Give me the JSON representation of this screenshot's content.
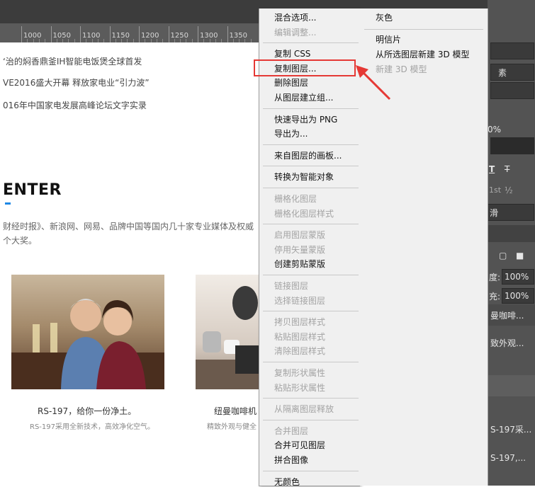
{
  "ruler": {
    "ticks": [
      "1000",
      "1050",
      "1100",
      "1150",
      "1200",
      "1250",
      "1300",
      "1350"
    ]
  },
  "canvas": {
    "news": [
      "‘治的焖香鼎釜IH智能电饭煲全球首发",
      "VE2016盛大开幕 释放家电业“引力波”",
      "016年中国家电发展高峰论坛文字实录"
    ],
    "section_title": "ENTER",
    "desc_line1": "财经时报》、新浪网、网易、品牌中国等国内几十家专业媒体及权威",
    "desc_line2": "个大奖。",
    "product1": {
      "title": "RS-197，给你一份净土。",
      "subtitle": "RS-197采用全新技术，高效净化空气。"
    },
    "product2": {
      "title": "纽曼咖啡机",
      "subtitle": "精致外观与健全"
    }
  },
  "context_menu": {
    "groups": [
      [
        {
          "label": "混合选项...",
          "enabled": true
        },
        {
          "label": "编辑调整...",
          "enabled": false
        }
      ],
      [
        {
          "label": "复制 CSS",
          "enabled": true
        },
        {
          "label": "复制图层...",
          "enabled": true,
          "highlighted": true
        },
        {
          "label": "删除图层",
          "enabled": true
        },
        {
          "label": "从图层建立组...",
          "enabled": true
        }
      ],
      [
        {
          "label": "快速导出为 PNG",
          "enabled": true
        },
        {
          "label": "导出为...",
          "enabled": true
        }
      ],
      [
        {
          "label": "来自图层的画板...",
          "enabled": true
        }
      ],
      [
        {
          "label": "转换为智能对象",
          "enabled": true
        }
      ],
      [
        {
          "label": "栅格化图层",
          "enabled": false
        },
        {
          "label": "栅格化图层样式",
          "enabled": false
        }
      ],
      [
        {
          "label": "启用图层蒙版",
          "enabled": false
        },
        {
          "label": "停用矢量蒙版",
          "enabled": false
        },
        {
          "label": "创建剪贴蒙版",
          "enabled": true
        }
      ],
      [
        {
          "label": "链接图层",
          "enabled": false
        },
        {
          "label": "选择链接图层",
          "enabled": false
        }
      ],
      [
        {
          "label": "拷贝图层样式",
          "enabled": false
        },
        {
          "label": "粘贴图层样式",
          "enabled": false
        },
        {
          "label": "清除图层样式",
          "enabled": false
        }
      ],
      [
        {
          "label": "复制形状属性",
          "enabled": false
        },
        {
          "label": "粘贴形状属性",
          "enabled": false
        }
      ],
      [
        {
          "label": "从隔离图层释放",
          "enabled": false
        }
      ],
      [
        {
          "label": "合并图层",
          "enabled": false
        },
        {
          "label": "合并可见图层",
          "enabled": true
        },
        {
          "label": "拼合图像",
          "enabled": true
        }
      ],
      [
        {
          "label": "无颜色",
          "enabled": true
        }
      ]
    ],
    "column2": [
      [
        {
          "label": "灰色",
          "enabled": true
        }
      ],
      [
        {
          "label": "明信片",
          "enabled": true
        },
        {
          "label": "从所选图层新建 3D 模型",
          "enabled": true
        },
        {
          "label": "新建 3D 模型",
          "enabled": false
        }
      ]
    ]
  },
  "right_panel": {
    "dropdown1": "素",
    "percent": "0%",
    "text_tool_t": "T",
    "text_tool_t2": "T",
    "sup1": "1st",
    "frac": "½",
    "smooth": "滑",
    "opacity_label": "度:",
    "opacity_value": "100%",
    "fill_label": "充:",
    "fill_value": "100%",
    "layer1": "曼咖啡...",
    "layer2": "致外观...",
    "layer3": "S-197采...",
    "layer4": "S-197,..."
  },
  "colors": {
    "highlight": "#e53935",
    "accent": "#1e88e5",
    "menu_bg": "#f0f0f0",
    "panel_bg": "#535353"
  }
}
